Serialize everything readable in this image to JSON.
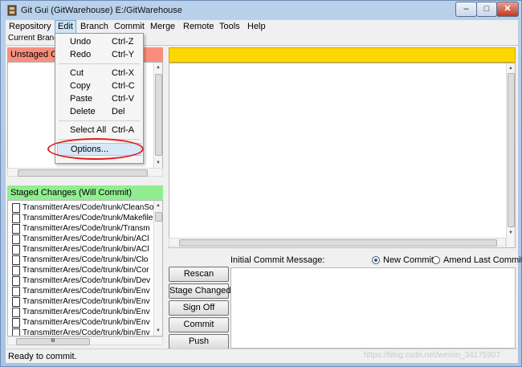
{
  "window": {
    "title": "Git Gui (GitWarehouse) E:/GitWarehouse",
    "minimize_glyph": "‒",
    "maximize_glyph": "□",
    "close_glyph": "✕"
  },
  "menubar": {
    "items": [
      "Repository",
      "Edit",
      "Branch",
      "Commit",
      "Merge",
      "Remote",
      "Tools",
      "Help"
    ],
    "active": "Edit"
  },
  "edit_menu": {
    "undo": {
      "label": "Undo",
      "accel": "Ctrl-Z"
    },
    "redo": {
      "label": "Redo",
      "accel": "Ctrl-Y"
    },
    "cut": {
      "label": "Cut",
      "accel": "Ctrl-X"
    },
    "copy": {
      "label": "Copy",
      "accel": "Ctrl-C"
    },
    "paste": {
      "label": "Paste",
      "accel": "Ctrl-V"
    },
    "delete": {
      "label": "Delete",
      "accel": "Del"
    },
    "select_all": {
      "label": "Select All",
      "accel": "Ctrl-A"
    },
    "options": {
      "label": "Options..."
    }
  },
  "current_branch": {
    "label": "Current Branch"
  },
  "unstaged": {
    "header": "Unstaged Changes"
  },
  "staged": {
    "header": "Staged Changes (Will Commit)",
    "files": [
      "TransmitterAres/Code/trunk/CleanSo",
      "TransmitterAres/Code/trunk/Makefile",
      "TransmitterAres/Code/trunk/Transm",
      "TransmitterAres/Code/trunk/bin/ACl",
      "TransmitterAres/Code/trunk/bin/ACl",
      "TransmitterAres/Code/trunk/bin/Clo",
      "TransmitterAres/Code/trunk/bin/Cor",
      "TransmitterAres/Code/trunk/bin/Dev",
      "TransmitterAres/Code/trunk/bin/Env",
      "TransmitterAres/Code/trunk/bin/Env",
      "TransmitterAres/Code/trunk/bin/Env",
      "TransmitterAres/Code/trunk/bin/Env",
      "TransmitterAres/Code/trunk/bin/Env"
    ],
    "hscroll_grip": "III"
  },
  "commit": {
    "message_label": "Initial Commit Message:",
    "new_commit": "New Commit",
    "amend_last_commit": "Amend Last Commit",
    "message_value": ""
  },
  "buttons": {
    "rescan": "Rescan",
    "stage_changed": "Stage Changed",
    "sign_off": "Sign Off",
    "commit": "Commit",
    "push": "Push"
  },
  "status": {
    "text": "Ready to commit."
  },
  "watermark": "https://blog.csdn.net/weixin_34175907",
  "colors": {
    "unstaged_header": "#f88f7d",
    "staged_header": "#90ee90",
    "diff_header": "#ffd700",
    "annotation_circle": "#e02020"
  }
}
